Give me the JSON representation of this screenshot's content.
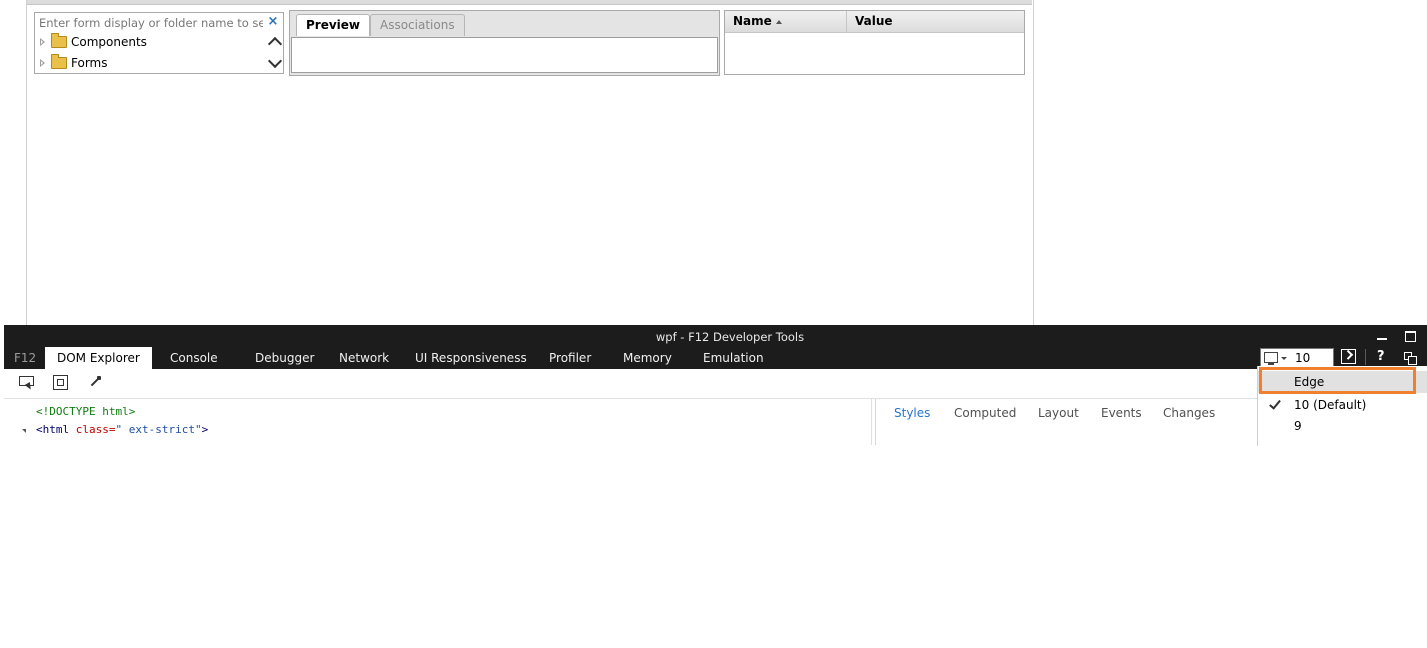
{
  "page": {
    "search": {
      "placeholder": "Enter form display or folder name to sea",
      "clear_label": "×"
    },
    "tree": {
      "items": [
        {
          "label": "Components",
          "icon": "folder-icon"
        },
        {
          "label": "Forms",
          "icon": "folder-icon"
        }
      ]
    },
    "preview": {
      "tabs": [
        {
          "label": "Preview",
          "active": true
        },
        {
          "label": "Associations",
          "active": false
        }
      ]
    },
    "grid": {
      "columns": [
        {
          "label": "Name",
          "sorted": "asc"
        },
        {
          "label": "Value"
        }
      ]
    }
  },
  "devtools": {
    "title": "wpf - F12 Developer Tools",
    "f12_label": "F12",
    "tabs": [
      {
        "label": "DOM Explorer",
        "active": true
      },
      {
        "label": "Console"
      },
      {
        "label": "Debugger"
      },
      {
        "label": "Network"
      },
      {
        "label": "UI Responsiveness"
      },
      {
        "label": "Profiler"
      },
      {
        "label": "Memory"
      },
      {
        "label": "Emulation"
      }
    ],
    "document_mode": {
      "value": "10",
      "options": [
        {
          "label": "Edge",
          "hovered": true
        },
        {
          "label": "10 (Default)",
          "checked": true
        },
        {
          "label": "9"
        }
      ]
    },
    "help_label": "?",
    "dom": {
      "doctype": "<!DOCTYPE html>",
      "html_open": "<html",
      "html_attr": "class=",
      "html_attr_value": "\" ext-strict\"",
      "html_close": ">"
    },
    "side_tabs": [
      {
        "label": "Styles",
        "active": true
      },
      {
        "label": "Computed"
      },
      {
        "label": "Layout"
      },
      {
        "label": "Events"
      },
      {
        "label": "Changes"
      }
    ]
  },
  "colors": {
    "highlight": "#f08030",
    "devtools_bg": "#1c1c1c",
    "active_tab": "#2876c8"
  }
}
